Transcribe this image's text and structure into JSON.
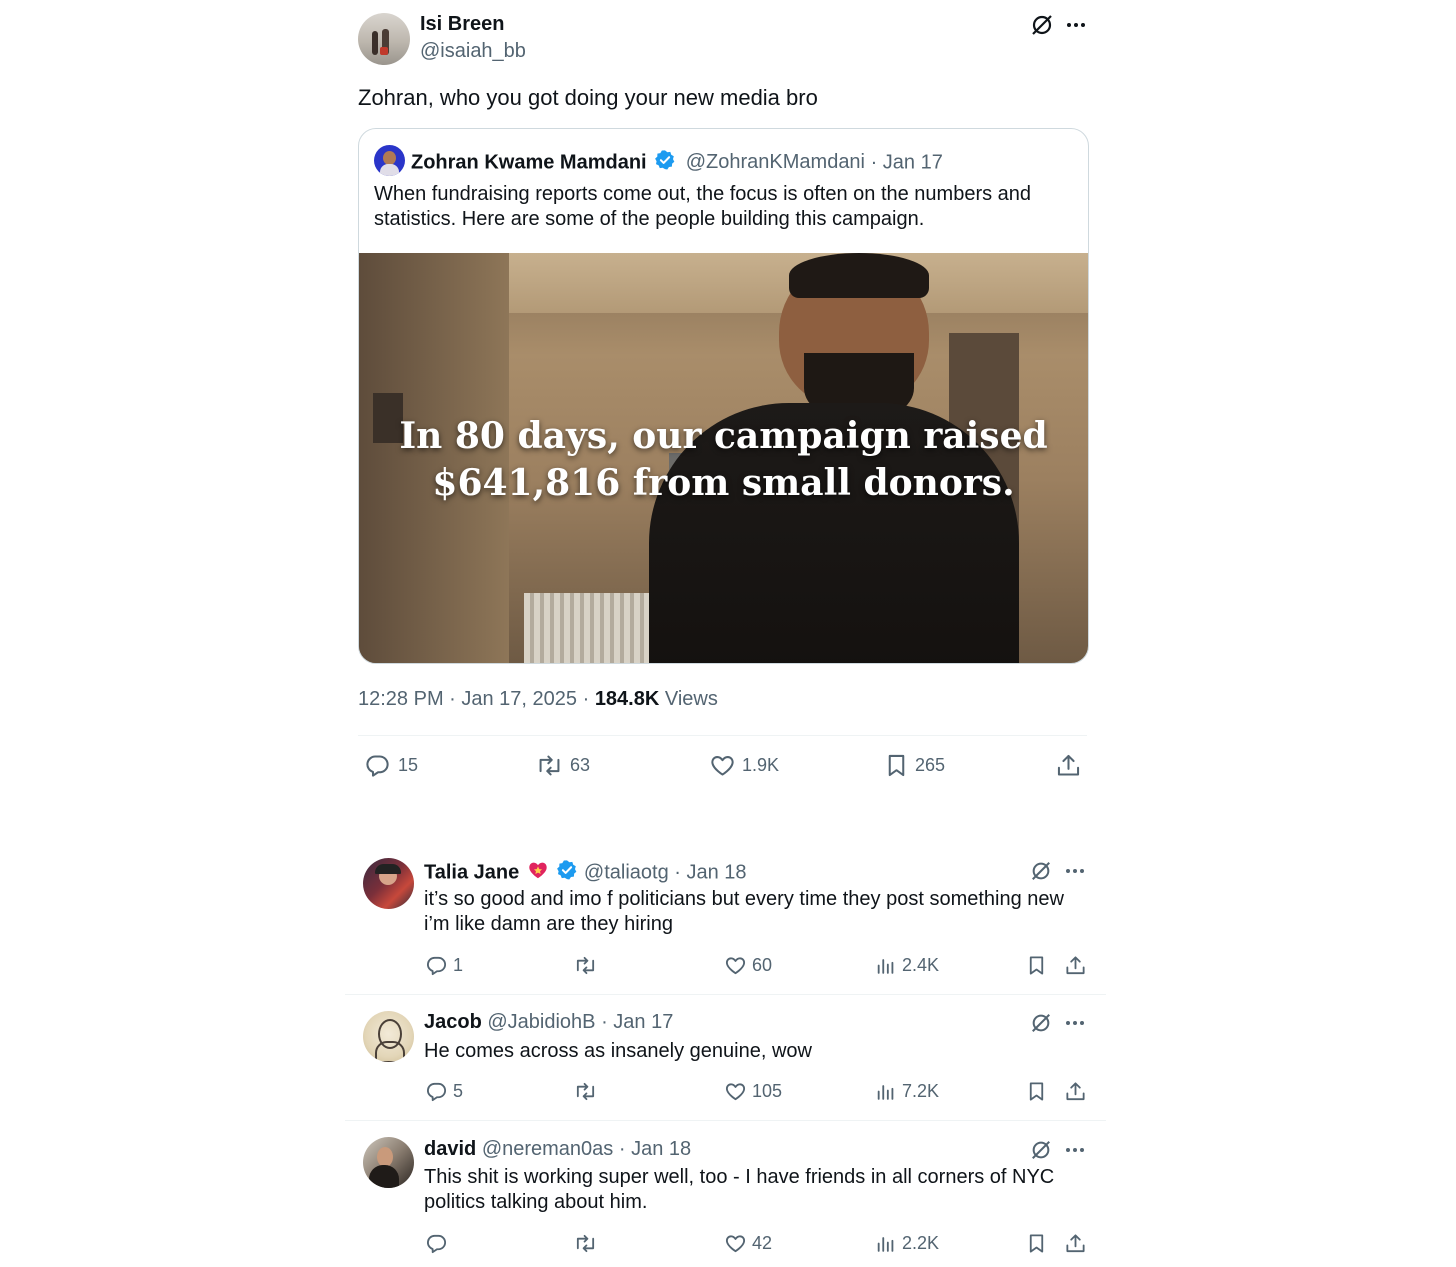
{
  "main_tweet": {
    "author_name": "Isi Breen",
    "author_handle": "@isaiah_bb",
    "text": "Zohran, who you got doing your new media bro",
    "quoted": {
      "author_name": "Zohran Kwame Mamdani",
      "author_handle": "@ZohranKMamdani",
      "date": "· Jan 17",
      "text_line1": "When fundraising reports come out, the focus is often on the numbers and",
      "text_line2": "statistics. Here are some of the people building this campaign.",
      "video_caption_line1": "In 80 days, our campaign raised",
      "video_caption_line2": "$641,816 from small donors."
    },
    "timestamp": "12:28 PM · Jan 17, 2025 ·",
    "views_count": "184.8K",
    "views_label": "Views",
    "actions": {
      "replies": "15",
      "reposts": "63",
      "likes": "1.9K",
      "bookmarks": "265"
    }
  },
  "replies": [
    {
      "author_name": "Talia Jane",
      "author_handle": "@taliaotg",
      "date": "· Jan 18",
      "text_line1": "it’s so good and imo f politicians but every time they post something new",
      "text_line2": "i’m like damn are they hiring",
      "replies": "1",
      "reposts": "",
      "likes": "60",
      "views": "2.4K"
    },
    {
      "author_name": "Jacob",
      "author_handle": "@JabidiohB",
      "date": "· Jan 17",
      "text_line1": "He comes across as insanely genuine, wow",
      "text_line2": "",
      "replies": "5",
      "reposts": "",
      "likes": "105",
      "views": "7.2K"
    },
    {
      "author_name": "david",
      "author_handle": "@nereman0as",
      "date": "· Jan 18",
      "text_line1": "This shit is working super well, too - I have friends in all corners of NYC",
      "text_line2": "politics talking about him.",
      "replies": "",
      "reposts": "",
      "likes": "42",
      "views": "2.2K"
    }
  ],
  "colors": {
    "text": "#0f1419",
    "muted": "#536471",
    "verified_blue": "#1d9bf0",
    "divider": "#eff3f4"
  }
}
